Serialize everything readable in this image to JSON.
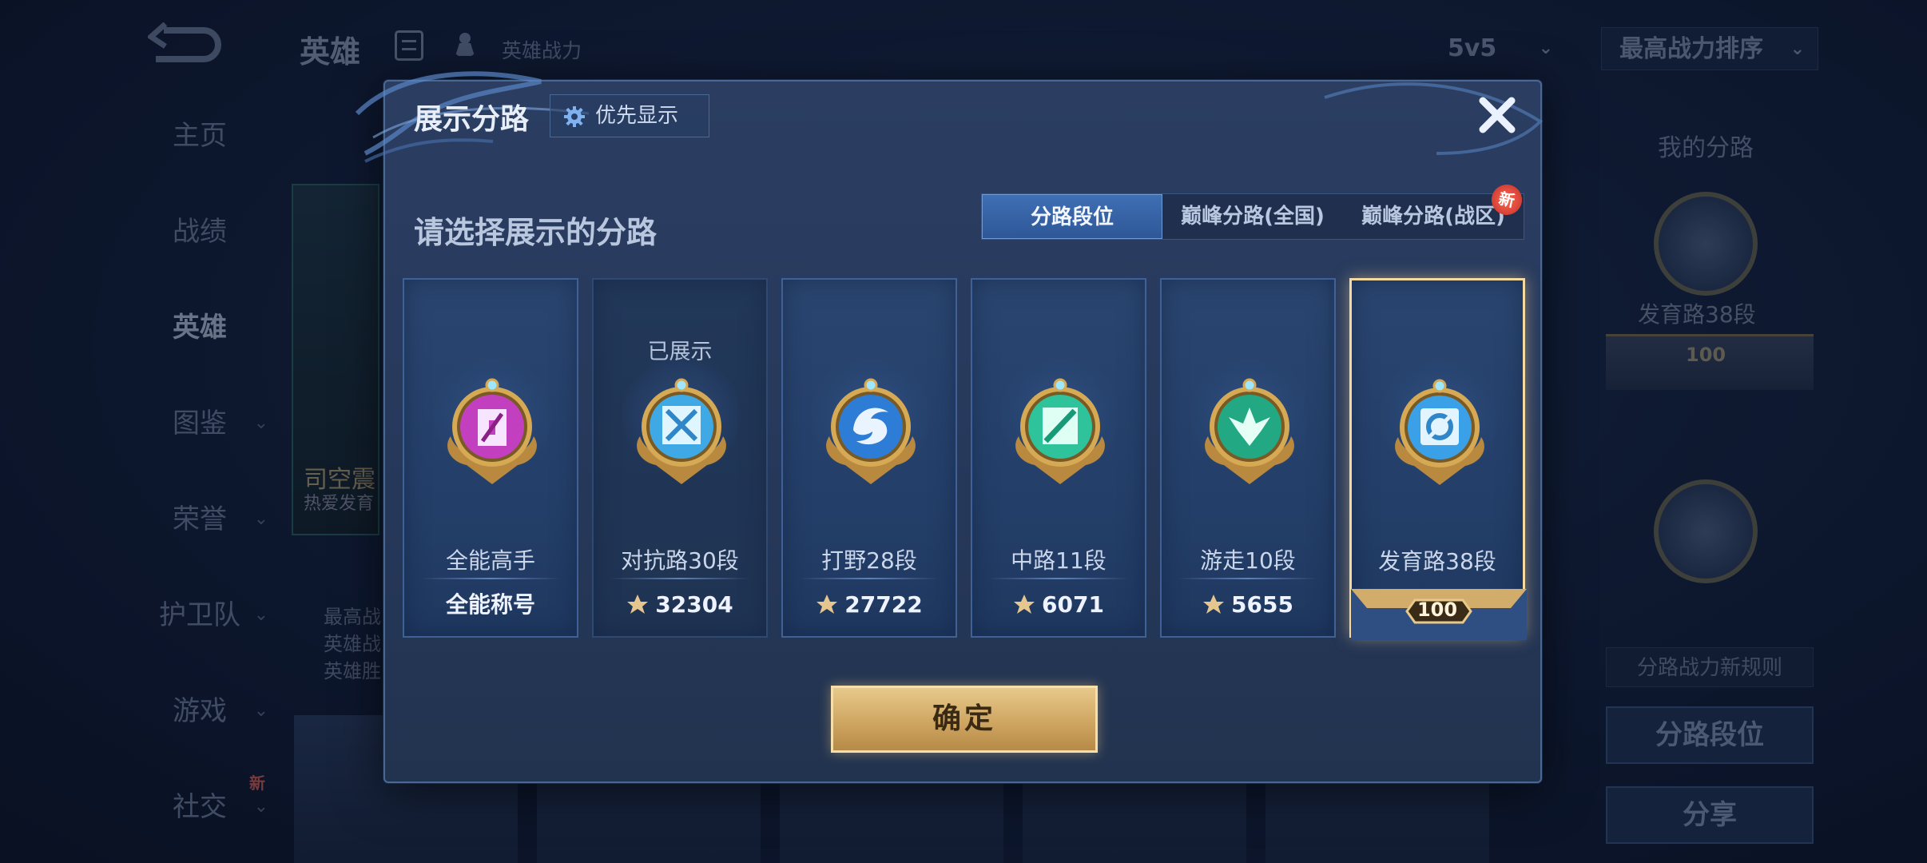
{
  "background": {
    "top_title": "英雄",
    "top_subtitle": "英雄战力",
    "mode_select": "5v5",
    "sort_select": "最高战力排序",
    "sidebar": [
      {
        "label": "主页",
        "active": false,
        "caret": false,
        "new": false
      },
      {
        "label": "战绩",
        "active": false,
        "caret": false,
        "new": false
      },
      {
        "label": "英雄",
        "active": true,
        "caret": false,
        "new": false
      },
      {
        "label": "图鉴",
        "active": false,
        "caret": true,
        "new": false
      },
      {
        "label": "荣誉",
        "active": false,
        "caret": true,
        "new": false
      },
      {
        "label": "护卫队",
        "active": false,
        "caret": true,
        "new": false
      },
      {
        "label": "游戏",
        "active": false,
        "caret": true,
        "new": false
      },
      {
        "label": "社交",
        "active": false,
        "caret": true,
        "new": true
      }
    ],
    "new_tag": "新",
    "hero_name": "司空震",
    "hero_tag": "热爱发育",
    "hero_stats": [
      "最高战",
      "英雄战",
      "英雄胜"
    ],
    "right_title": "我的分路",
    "right_emblem_label": "发育路38段",
    "right_badge_num": "100",
    "right_rule": "分路战力新规则",
    "right_btn_rank": "分路段位",
    "right_btn_share": "分享"
  },
  "modal": {
    "title": "展示分路",
    "priority_button": "优先显示",
    "prompt": "请选择展示的分路",
    "tabs": [
      {
        "label": "分路段位",
        "active": true,
        "new": false
      },
      {
        "label": "巅峰分路(全国)",
        "active": false,
        "new": false
      },
      {
        "label": "巅峰分路(战区)",
        "active": false,
        "new": true
      }
    ],
    "tab_new_badge": "新",
    "cards": [
      {
        "label": "全能高手",
        "foot": "全能称号",
        "status": "",
        "power": false,
        "selected": false,
        "emblem_color": "#c23fbf",
        "emblem": "allround"
      },
      {
        "label": "对抗路30段",
        "foot": "32304",
        "status": "已展示",
        "power": true,
        "selected": false,
        "emblem_color": "#3fa9e6",
        "emblem": "clash"
      },
      {
        "label": "打野28段",
        "foot": "27722",
        "status": "",
        "power": true,
        "selected": false,
        "emblem_color": "#2d7cd6",
        "emblem": "jungle"
      },
      {
        "label": "中路11段",
        "foot": "6071",
        "status": "",
        "power": true,
        "selected": false,
        "emblem_color": "#2fc39b",
        "emblem": "mid"
      },
      {
        "label": "游走10段",
        "foot": "5655",
        "status": "",
        "power": true,
        "selected": false,
        "emblem_color": "#22a882",
        "emblem": "roam"
      },
      {
        "label": "发育路38段",
        "foot": "",
        "status": "",
        "power": false,
        "selected": true,
        "emblem_color": "#3aa1e8",
        "emblem": "farm",
        "badge_num": "100"
      }
    ],
    "confirm": "确定"
  }
}
